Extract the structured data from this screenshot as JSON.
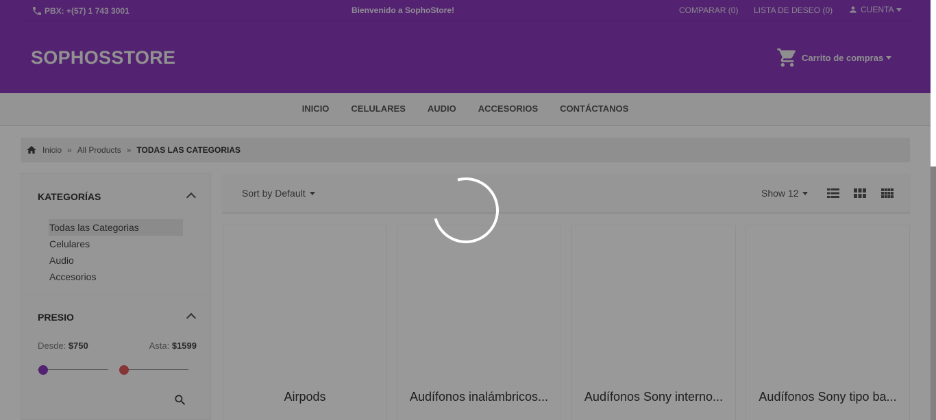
{
  "header": {
    "phone": "PBX: +(57) 1 743 3001",
    "welcome": "Bienvenido a SophoStore!",
    "compare": "COMPARAR (0)",
    "wishlist": "LISTA DE DESEO (0)",
    "account": "CUENTA",
    "logo": "SOPHOSSTORE",
    "cart": "Carrito de compras",
    "brand_color": "#8b3bbe"
  },
  "nav": {
    "items": [
      "INICIO",
      "CELULARES",
      "AUDIO",
      "ACCESORIOS",
      "CONTÁCTANOS"
    ]
  },
  "breadcrumb": {
    "home": "Inicio",
    "sep": "»",
    "parent": "All Products",
    "current": "TODAS LAS CATEGORIAS"
  },
  "sidebar": {
    "categories_title": "KATEGORÍAS",
    "categories": [
      "Todas las Categorias",
      "Celulares",
      "Audio",
      "Accesorios"
    ],
    "active_category": "Todas las Categorias",
    "price_title": "PRESIO",
    "from_label": "Desde:",
    "from_value": "$750",
    "to_label": "Asta:",
    "to_value": "$1599"
  },
  "toolbar": {
    "sort": "Sort by Default",
    "show": "Show 12",
    "views": [
      "list-view-icon",
      "grid-view-icon",
      "grid-small-view-icon"
    ]
  },
  "products": [
    {
      "name": "Airpods"
    },
    {
      "name": "Audífonos inalámbricos..."
    },
    {
      "name": "Audífonos Sony interno..."
    },
    {
      "name": "Audífonos Sony tipo ba..."
    }
  ],
  "loading": {
    "spinner": "loading-spinner"
  }
}
